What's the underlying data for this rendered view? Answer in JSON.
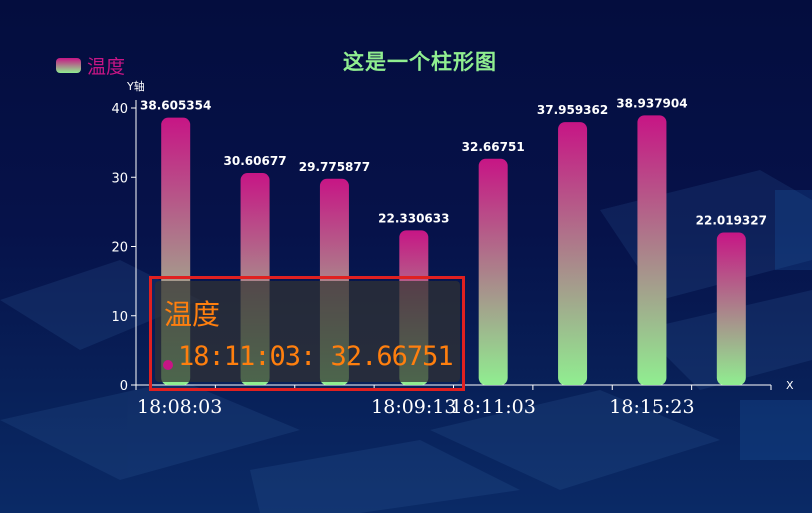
{
  "legend": {
    "label": "温度"
  },
  "title": "这是一个柱形图",
  "colors": {
    "bar_top": "#c71585",
    "bar_bottom": "#90ee90",
    "title": "#90ee90",
    "tooltip_text": "#ff7f0e",
    "highlight": "#e02020"
  },
  "chart_data": {
    "type": "bar",
    "title": "这是一个柱形图",
    "ylabel": "Y轴",
    "xlabel": "X",
    "ylim": [
      0,
      40
    ],
    "yticks": [
      0,
      10,
      20,
      30,
      40
    ],
    "categories": [
      "18:08:03",
      "",
      "",
      "18:09:13",
      "18:11:03",
      "",
      "18:15:23",
      ""
    ],
    "series": [
      {
        "name": "温度",
        "values": [
          38.605354,
          30.60677,
          29.775877,
          22.330633,
          32.66751,
          37.959362,
          38.937904,
          22.019327
        ]
      }
    ],
    "data_labels": [
      "38.605354",
      "30.60677",
      "29.775877",
      "22.330633",
      "32.66751",
      "37.959362",
      "38.937904",
      "22.019327"
    ],
    "legend_position": "top-left",
    "grid": false
  },
  "tooltip": {
    "title": "温度",
    "line": "18:11:03: 32.66751"
  }
}
